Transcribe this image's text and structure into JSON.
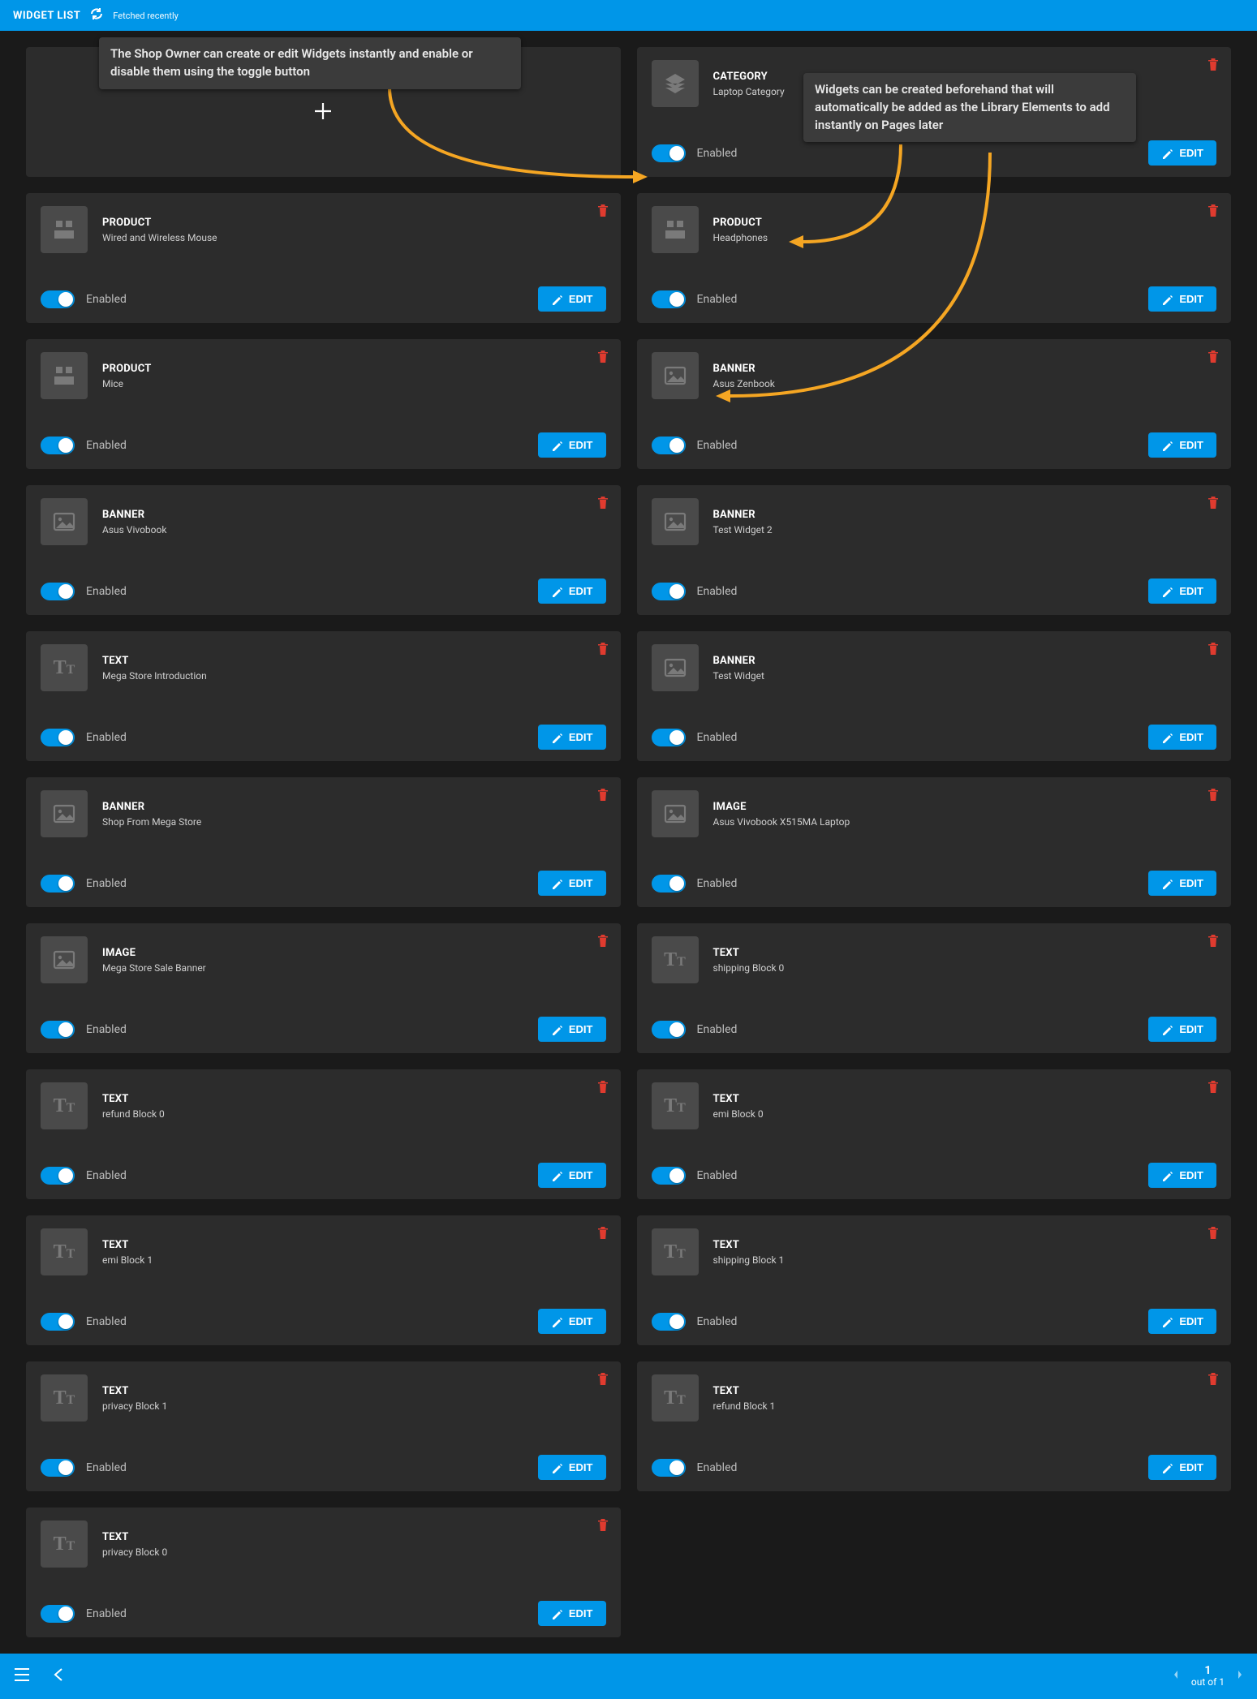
{
  "topbar": {
    "title": "WIDGET LIST",
    "status": "Fetched recently"
  },
  "callouts": {
    "a": "The Shop Owner can create or edit Widgets instantly and enable or disable them using the toggle button",
    "b": "Widgets can be created beforehand that will automatically be added as the Library Elements to add instantly on Pages later"
  },
  "labels": {
    "enabled": "Enabled",
    "edit": "EDIT"
  },
  "pagination": {
    "page": "1",
    "total": "out of 1"
  },
  "icons": {
    "CATEGORY": "layers",
    "PRODUCT": "product",
    "BANNER": "image",
    "IMAGE": "image",
    "TEXT": "tt"
  },
  "widgets": [
    {
      "slot": "add"
    },
    {
      "type": "CATEGORY",
      "name": "Laptop Category"
    },
    {
      "type": "PRODUCT",
      "name": "Wired and Wireless Mouse"
    },
    {
      "type": "PRODUCT",
      "name": "Headphones"
    },
    {
      "type": "PRODUCT",
      "name": "Mice"
    },
    {
      "type": "BANNER",
      "name": "Asus Zenbook"
    },
    {
      "type": "BANNER",
      "name": "Asus Vivobook"
    },
    {
      "type": "BANNER",
      "name": "Test Widget 2"
    },
    {
      "type": "TEXT",
      "name": "Mega Store Introduction"
    },
    {
      "type": "BANNER",
      "name": "Test Widget"
    },
    {
      "type": "BANNER",
      "name": "Shop From Mega Store"
    },
    {
      "type": "IMAGE",
      "name": "Asus Vivobook X515MA Laptop"
    },
    {
      "type": "IMAGE",
      "name": "Mega Store Sale Banner"
    },
    {
      "type": "TEXT",
      "name": "shipping Block 0"
    },
    {
      "type": "TEXT",
      "name": "refund Block 0"
    },
    {
      "type": "TEXT",
      "name": "emi Block 0"
    },
    {
      "type": "TEXT",
      "name": "emi Block 1"
    },
    {
      "type": "TEXT",
      "name": "shipping Block 1"
    },
    {
      "type": "TEXT",
      "name": "privacy Block 1"
    },
    {
      "type": "TEXT",
      "name": "refund Block 1"
    },
    {
      "type": "TEXT",
      "name": "privacy Block 0"
    }
  ]
}
